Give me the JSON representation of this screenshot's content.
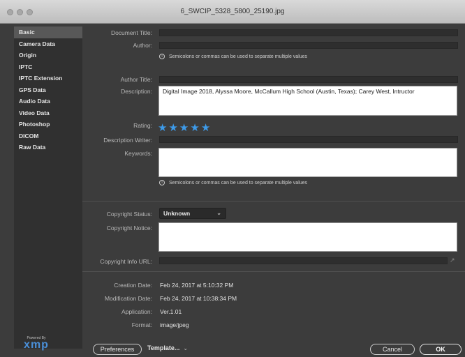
{
  "window": {
    "title": "6_SWCIP_5328_5800_25190.jpg"
  },
  "sidebar": {
    "items": [
      {
        "label": "Basic"
      },
      {
        "label": "Camera Data"
      },
      {
        "label": "Origin"
      },
      {
        "label": "IPTC"
      },
      {
        "label": "IPTC Extension"
      },
      {
        "label": "GPS Data"
      },
      {
        "label": "Audio Data"
      },
      {
        "label": "Video Data"
      },
      {
        "label": "Photoshop"
      },
      {
        "label": "DICOM"
      },
      {
        "label": "Raw Data"
      }
    ],
    "active_index": 0,
    "logo": {
      "powered": "Powered By",
      "name": "xmp"
    }
  },
  "form": {
    "document_title": {
      "label": "Document Title:",
      "value": ""
    },
    "author": {
      "label": "Author:",
      "value": ""
    },
    "author_hint": "Semicolons or commas can be used to separate multiple values",
    "author_title": {
      "label": "Author Title:",
      "value": ""
    },
    "description": {
      "label": "Description:",
      "value": "Digital Image 2018, Alyssa Moore, McCallum High School (Austin, Texas); Carey West, Intructor"
    },
    "rating": {
      "label": "Rating:",
      "stars": 5,
      "max": 5,
      "star_color": "#3d9bea"
    },
    "description_writer": {
      "label": "Description Writer:",
      "value": ""
    },
    "keywords": {
      "label": "Keywords:",
      "value": ""
    },
    "keywords_hint": "Semicolons or commas can be used to separate multiple values",
    "copyright_status": {
      "label": "Copyright Status:",
      "value": "Unknown"
    },
    "copyright_notice": {
      "label": "Copyright Notice:",
      "value": ""
    },
    "copyright_info_url": {
      "label": "Copyright Info URL:",
      "value": ""
    }
  },
  "file_info": {
    "creation_date": {
      "label": "Creation Date:",
      "value": "Feb 24, 2017 at 5:10:32 PM"
    },
    "modification_date": {
      "label": "Modification Date:",
      "value": "Feb 24, 2017 at 10:38:34 PM"
    },
    "application": {
      "label": "Application:",
      "value": "Ver.1.01"
    },
    "format": {
      "label": "Format:",
      "value": "image/jpeg"
    }
  },
  "footer": {
    "preferences_label": "Preferences",
    "template_label": "Template...",
    "cancel_label": "Cancel",
    "ok_label": "OK"
  }
}
